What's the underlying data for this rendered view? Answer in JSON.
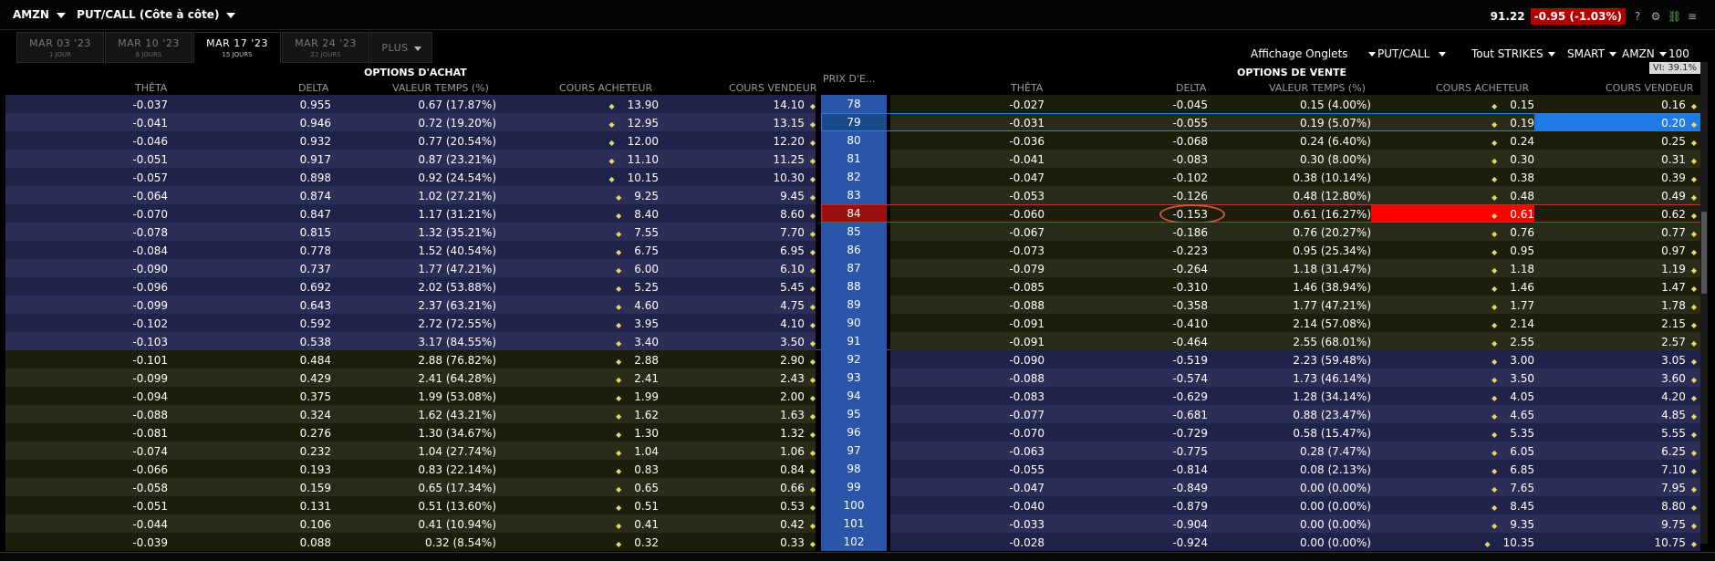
{
  "topbar": {
    "symbol": "AMZN",
    "view_title": "PUT/CALL (Côte à côte)",
    "last_price": "91.22",
    "change": "-0.95",
    "change_pct": "(-1.03%)",
    "icons": [
      "question-icon",
      "gear-icon",
      "link-icon",
      "menu-icon"
    ],
    "help_label": "?"
  },
  "tabs": [
    {
      "date": "MAR 03 '23",
      "sub": "1 JOUR",
      "active": false
    },
    {
      "date": "MAR 10 '23",
      "sub": "8 JOURS",
      "active": false
    },
    {
      "date": "MAR 17 '23",
      "sub": "15 JOURS",
      "active": true
    },
    {
      "date": "MAR 24 '23",
      "sub": "22 JOURS",
      "active": false
    }
  ],
  "more_label": "PLUS",
  "toolbar": {
    "tabs_display": "Affichage Onglets",
    "putcall": "PUT/CALL",
    "strikes": "Tout STRIKES",
    "exchange": "SMART",
    "underlying": "AMZN",
    "multiplier": "100"
  },
  "vi": "VI: 39.1%",
  "calls_title": "OPTIONS D'ACHAT",
  "puts_title": "OPTIONS DE VENTE",
  "headers": {
    "theta": "THÊTA",
    "delta": "DELTA",
    "time_value": "VALEUR TEMPS (%)",
    "bid": "COURS ACHETEUR",
    "ask": "COURS VENDEUR",
    "strike": "PRIX D'E..."
  },
  "colors": {
    "accent_blue": "#2a55a8",
    "selected_ask": "#1e7ae6",
    "red_highlight": "#ff0000",
    "change_bg": "#b00000"
  },
  "rows": [
    {
      "strike": "78",
      "c_theta": "-0.037",
      "c_delta": "0.955",
      "c_tv": "0.67 (17.87%)",
      "c_bid": "13.90",
      "c_ask": "14.10",
      "p_theta": "-0.027",
      "p_delta": "-0.045",
      "p_tv": "0.15 (4.00%)",
      "p_bid": "0.15",
      "p_ask": "0.16"
    },
    {
      "strike": "79",
      "c_theta": "-0.041",
      "c_delta": "0.946",
      "c_tv": "0.72 (19.20%)",
      "c_bid": "12.95",
      "c_ask": "13.15",
      "p_theta": "-0.031",
      "p_delta": "-0.055",
      "p_tv": "0.19 (5.07%)",
      "p_bid": "0.19",
      "p_ask": "0.20"
    },
    {
      "strike": "80",
      "c_theta": "-0.046",
      "c_delta": "0.932",
      "c_tv": "0.77 (20.54%)",
      "c_bid": "12.00",
      "c_ask": "12.20",
      "p_theta": "-0.036",
      "p_delta": "-0.068",
      "p_tv": "0.24 (6.40%)",
      "p_bid": "0.24",
      "p_ask": "0.25"
    },
    {
      "strike": "81",
      "c_theta": "-0.051",
      "c_delta": "0.917",
      "c_tv": "0.87 (23.21%)",
      "c_bid": "11.10",
      "c_ask": "11.25",
      "p_theta": "-0.041",
      "p_delta": "-0.083",
      "p_tv": "0.30 (8.00%)",
      "p_bid": "0.30",
      "p_ask": "0.31"
    },
    {
      "strike": "82",
      "c_theta": "-0.057",
      "c_delta": "0.898",
      "c_tv": "0.92 (24.54%)",
      "c_bid": "10.15",
      "c_ask": "10.30",
      "p_theta": "-0.047",
      "p_delta": "-0.102",
      "p_tv": "0.38 (10.14%)",
      "p_bid": "0.38",
      "p_ask": "0.39"
    },
    {
      "strike": "83",
      "c_theta": "-0.064",
      "c_delta": "0.874",
      "c_tv": "1.02 (27.21%)",
      "c_bid": "9.25",
      "c_ask": "9.45",
      "p_theta": "-0.053",
      "p_delta": "-0.126",
      "p_tv": "0.48 (12.80%)",
      "p_bid": "0.48",
      "p_ask": "0.49"
    },
    {
      "strike": "84",
      "c_theta": "-0.070",
      "c_delta": "0.847",
      "c_tv": "1.17 (31.21%)",
      "c_bid": "8.40",
      "c_ask": "8.60",
      "p_theta": "-0.060",
      "p_delta": "-0.153",
      "p_tv": "0.61 (16.27%)",
      "p_bid": "0.61",
      "p_ask": "0.62"
    },
    {
      "strike": "85",
      "c_theta": "-0.078",
      "c_delta": "0.815",
      "c_tv": "1.32 (35.21%)",
      "c_bid": "7.55",
      "c_ask": "7.70",
      "p_theta": "-0.067",
      "p_delta": "-0.186",
      "p_tv": "0.76 (20.27%)",
      "p_bid": "0.76",
      "p_ask": "0.77"
    },
    {
      "strike": "86",
      "c_theta": "-0.084",
      "c_delta": "0.778",
      "c_tv": "1.52 (40.54%)",
      "c_bid": "6.75",
      "c_ask": "6.95",
      "p_theta": "-0.073",
      "p_delta": "-0.223",
      "p_tv": "0.95 (25.34%)",
      "p_bid": "0.95",
      "p_ask": "0.97"
    },
    {
      "strike": "87",
      "c_theta": "-0.090",
      "c_delta": "0.737",
      "c_tv": "1.77 (47.21%)",
      "c_bid": "6.00",
      "c_ask": "6.10",
      "p_theta": "-0.079",
      "p_delta": "-0.264",
      "p_tv": "1.18 (31.47%)",
      "p_bid": "1.18",
      "p_ask": "1.19"
    },
    {
      "strike": "88",
      "c_theta": "-0.096",
      "c_delta": "0.692",
      "c_tv": "2.02 (53.88%)",
      "c_bid": "5.25",
      "c_ask": "5.45",
      "p_theta": "-0.085",
      "p_delta": "-0.310",
      "p_tv": "1.46 (38.94%)",
      "p_bid": "1.46",
      "p_ask": "1.47"
    },
    {
      "strike": "89",
      "c_theta": "-0.099",
      "c_delta": "0.643",
      "c_tv": "2.37 (63.21%)",
      "c_bid": "4.60",
      "c_ask": "4.75",
      "p_theta": "-0.088",
      "p_delta": "-0.358",
      "p_tv": "1.77 (47.21%)",
      "p_bid": "1.77",
      "p_ask": "1.78"
    },
    {
      "strike": "90",
      "c_theta": "-0.102",
      "c_delta": "0.592",
      "c_tv": "2.72 (72.55%)",
      "c_bid": "3.95",
      "c_ask": "4.10",
      "p_theta": "-0.091",
      "p_delta": "-0.410",
      "p_tv": "2.14 (57.08%)",
      "p_bid": "2.14",
      "p_ask": "2.15"
    },
    {
      "strike": "91",
      "c_theta": "-0.103",
      "c_delta": "0.538",
      "c_tv": "3.17 (84.55%)",
      "c_bid": "3.40",
      "c_ask": "3.50",
      "p_theta": "-0.091",
      "p_delta": "-0.464",
      "p_tv": "2.55 (68.01%)",
      "p_bid": "2.55",
      "p_ask": "2.57"
    },
    {
      "strike": "92",
      "c_theta": "-0.101",
      "c_delta": "0.484",
      "c_tv": "2.88 (76.82%)",
      "c_bid": "2.88",
      "c_ask": "2.90",
      "p_theta": "-0.090",
      "p_delta": "-0.519",
      "p_tv": "2.23 (59.48%)",
      "p_bid": "3.00",
      "p_ask": "3.05"
    },
    {
      "strike": "93",
      "c_theta": "-0.099",
      "c_delta": "0.429",
      "c_tv": "2.41 (64.28%)",
      "c_bid": "2.41",
      "c_ask": "2.43",
      "p_theta": "-0.088",
      "p_delta": "-0.574",
      "p_tv": "1.73 (46.14%)",
      "p_bid": "3.50",
      "p_ask": "3.60"
    },
    {
      "strike": "94",
      "c_theta": "-0.094",
      "c_delta": "0.375",
      "c_tv": "1.99 (53.08%)",
      "c_bid": "1.99",
      "c_ask": "2.00",
      "p_theta": "-0.083",
      "p_delta": "-0.629",
      "p_tv": "1.28 (34.14%)",
      "p_bid": "4.05",
      "p_ask": "4.20"
    },
    {
      "strike": "95",
      "c_theta": "-0.088",
      "c_delta": "0.324",
      "c_tv": "1.62 (43.21%)",
      "c_bid": "1.62",
      "c_ask": "1.63",
      "p_theta": "-0.077",
      "p_delta": "-0.681",
      "p_tv": "0.88 (23.47%)",
      "p_bid": "4.65",
      "p_ask": "4.85"
    },
    {
      "strike": "96",
      "c_theta": "-0.081",
      "c_delta": "0.276",
      "c_tv": "1.30 (34.67%)",
      "c_bid": "1.30",
      "c_ask": "1.32",
      "p_theta": "-0.070",
      "p_delta": "-0.729",
      "p_tv": "0.58 (15.47%)",
      "p_bid": "5.35",
      "p_ask": "5.55"
    },
    {
      "strike": "97",
      "c_theta": "-0.074",
      "c_delta": "0.232",
      "c_tv": "1.04 (27.74%)",
      "c_bid": "1.04",
      "c_ask": "1.06",
      "p_theta": "-0.063",
      "p_delta": "-0.775",
      "p_tv": "0.28 (7.47%)",
      "p_bid": "6.05",
      "p_ask": "6.25"
    },
    {
      "strike": "98",
      "c_theta": "-0.066",
      "c_delta": "0.193",
      "c_tv": "0.83 (22.14%)",
      "c_bid": "0.83",
      "c_ask": "0.84",
      "p_theta": "-0.055",
      "p_delta": "-0.814",
      "p_tv": "0.08 (2.13%)",
      "p_bid": "6.85",
      "p_ask": "7.10"
    },
    {
      "strike": "99",
      "c_theta": "-0.058",
      "c_delta": "0.159",
      "c_tv": "0.65 (17.34%)",
      "c_bid": "0.65",
      "c_ask": "0.66",
      "p_theta": "-0.047",
      "p_delta": "-0.849",
      "p_tv": "0.00 (0.00%)",
      "p_bid": "7.65",
      "p_ask": "7.95"
    },
    {
      "strike": "100",
      "c_theta": "-0.051",
      "c_delta": "0.131",
      "c_tv": "0.51 (13.60%)",
      "c_bid": "0.51",
      "c_ask": "0.53",
      "p_theta": "-0.040",
      "p_delta": "-0.879",
      "p_tv": "0.00 (0.00%)",
      "p_bid": "8.45",
      "p_ask": "8.80"
    },
    {
      "strike": "101",
      "c_theta": "-0.044",
      "c_delta": "0.106",
      "c_tv": "0.41 (10.94%)",
      "c_bid": "0.41",
      "c_ask": "0.42",
      "p_theta": "-0.033",
      "p_delta": "-0.904",
      "p_tv": "0.00 (0.00%)",
      "p_bid": "9.35",
      "p_ask": "9.75"
    },
    {
      "strike": "102",
      "c_theta": "-0.039",
      "c_delta": "0.088",
      "c_tv": "0.32 (8.54%)",
      "c_bid": "0.32",
      "c_ask": "0.33",
      "p_theta": "-0.028",
      "p_delta": "-0.924",
      "p_tv": "0.00 (0.00%)",
      "p_bid": "10.35",
      "p_ask": "10.75"
    }
  ]
}
